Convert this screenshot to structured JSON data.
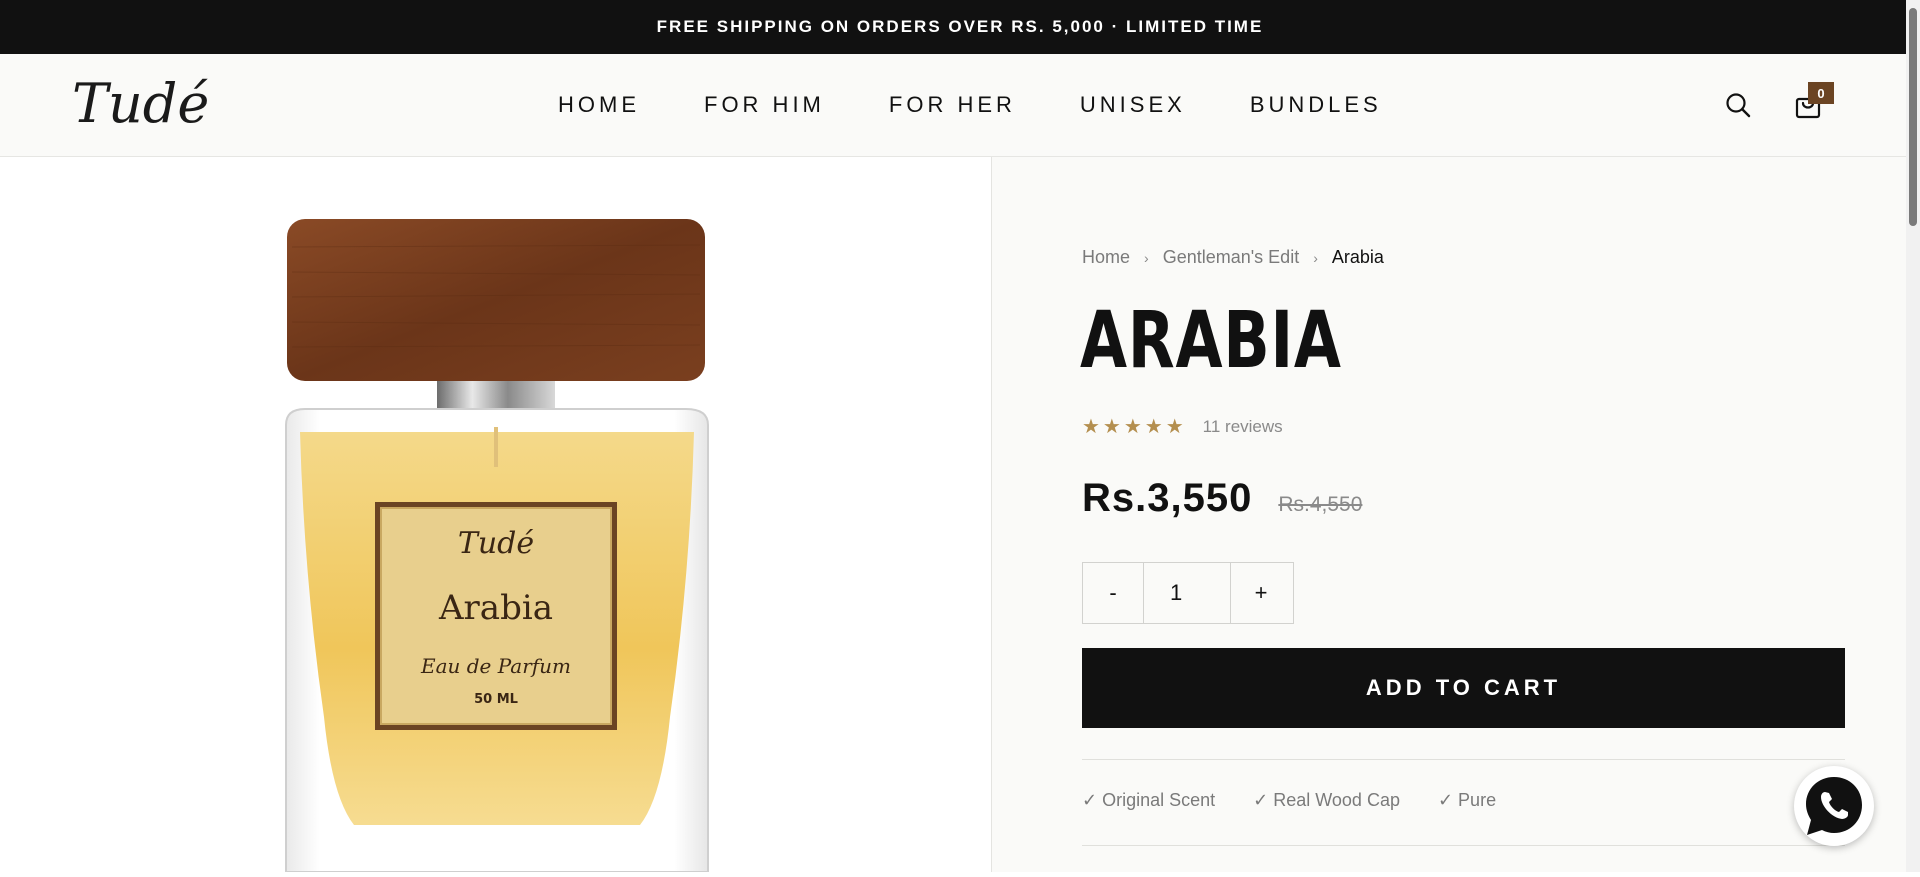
{
  "announcement": "FREE SHIPPING ON ORDERS OVER RS. 5,000 · LIMITED TIME",
  "header": {
    "logo": "Tudé",
    "nav": [
      "HOME",
      "FOR HIM",
      "FOR HER",
      "UNISEX",
      "BUNDLES"
    ],
    "search_icon": "search-icon",
    "cart_icon": "cart-icon",
    "cart_count": "0"
  },
  "product_image": {
    "label_brand": "Tudé",
    "label_name": "Arabia",
    "label_type": "Eau de Parfum",
    "label_size": "50 ML"
  },
  "breadcrumb": [
    "Home",
    "Gentleman's Edit",
    "Arabia"
  ],
  "product": {
    "title": "ARABIA",
    "stars": "★★★★★",
    "rating": 5,
    "reviews": "11 reviews",
    "price": "Rs.3,550",
    "compare_price": "Rs.4,550",
    "quantity": "1",
    "minus": "-",
    "plus": "+",
    "add_to_cart": "ADD TO CART",
    "features": [
      "✓ Original Scent",
      "✓ Real Wood Cap",
      "✓ Pure"
    ]
  },
  "colors": {
    "accent": "#111111",
    "star": "#b48f4f",
    "cart_badge": "#6b4423",
    "whatsapp": "#111111"
  }
}
